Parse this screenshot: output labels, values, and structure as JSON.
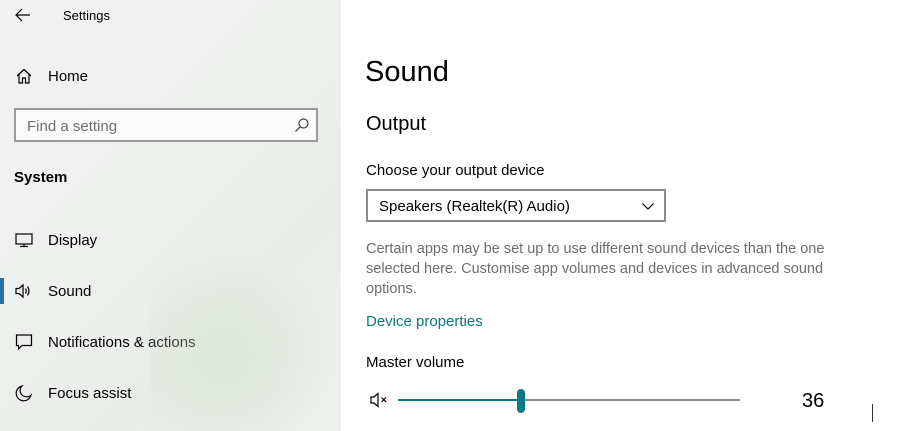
{
  "window": {
    "title": "Settings"
  },
  "sidebar": {
    "home_label": "Home",
    "search": {
      "placeholder": "Find a setting",
      "value": ""
    },
    "section_header": "System",
    "items": [
      {
        "label": "Display",
        "icon": "display-icon",
        "selected": false
      },
      {
        "label": "Sound",
        "icon": "speaker-icon",
        "selected": true
      },
      {
        "label": "Notifications & actions",
        "icon": "notifications-icon",
        "selected": false
      },
      {
        "label": "Focus assist",
        "icon": "moon-icon",
        "selected": false
      }
    ]
  },
  "main": {
    "page_title": "Sound",
    "output": {
      "section_title": "Output",
      "device_label": "Choose your output device",
      "device_selected": "Speakers (Realtek(R) Audio)",
      "help_text": "Certain apps may be set up to use different sound devices than the one selected here. Customise app volumes and devices in advanced sound options.",
      "device_properties_link": "Device properties",
      "master_volume_label": "Master volume",
      "master_volume_value": "36"
    }
  },
  "colors": {
    "accent": "#0a7887",
    "selection_bar": "#2c6e9b",
    "help_text": "#6d6d6d"
  }
}
